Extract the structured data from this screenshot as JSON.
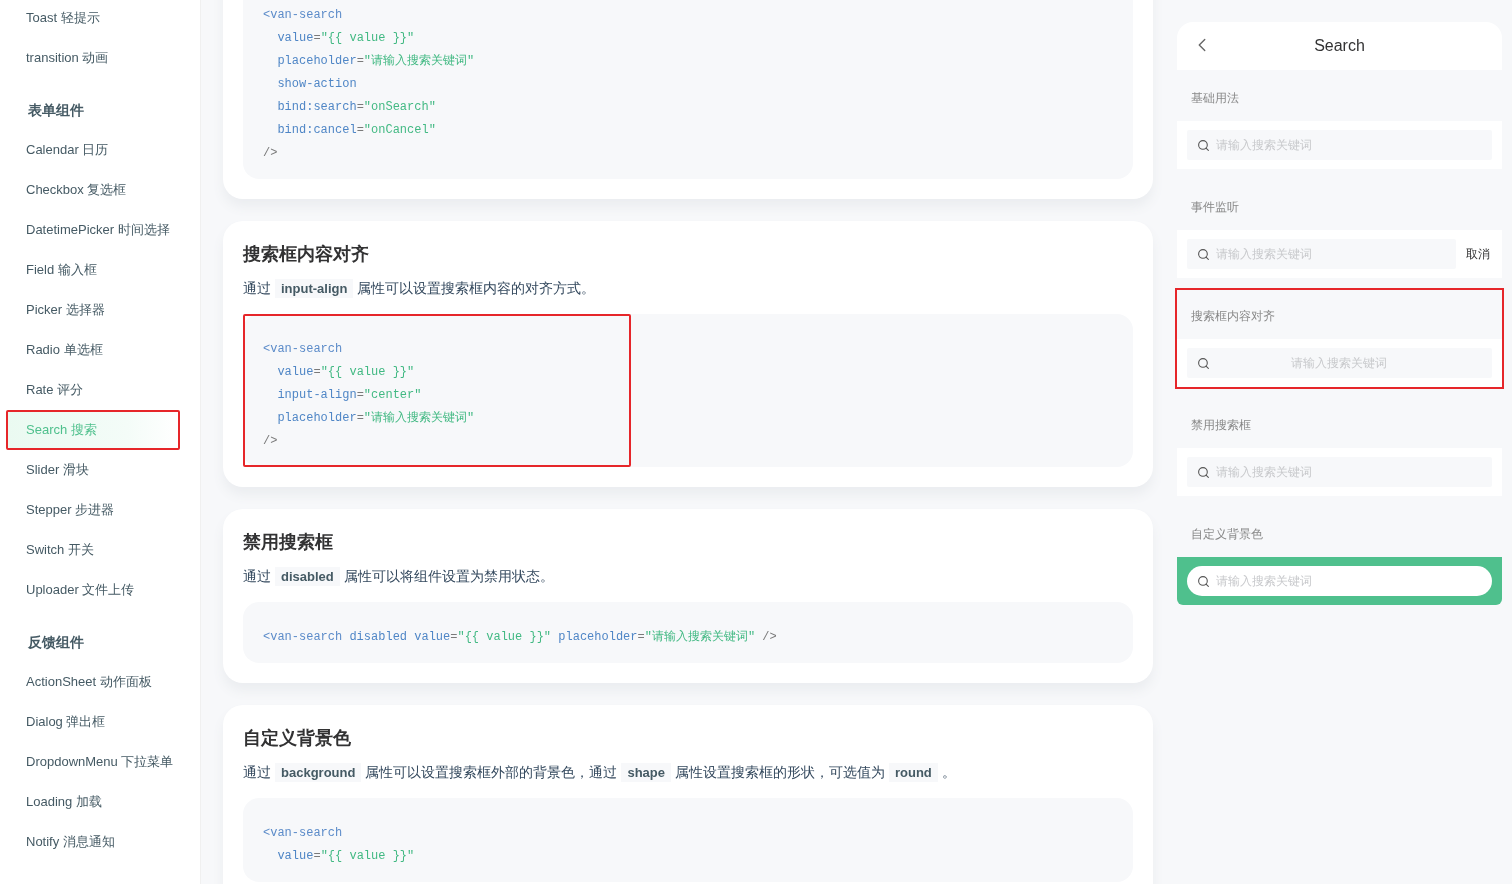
{
  "sidebar": {
    "items": [
      {
        "kind": "link",
        "label": "Toast 轻提示",
        "selected": false,
        "highlighted": false
      },
      {
        "kind": "link",
        "label": "transition 动画",
        "selected": false,
        "highlighted": false
      },
      {
        "kind": "heading",
        "label": "表单组件"
      },
      {
        "kind": "link",
        "label": "Calendar 日历",
        "selected": false,
        "highlighted": false
      },
      {
        "kind": "link",
        "label": "Checkbox 复选框",
        "selected": false,
        "highlighted": false
      },
      {
        "kind": "link",
        "label": "DatetimePicker 时间选择",
        "selected": false,
        "highlighted": false
      },
      {
        "kind": "link",
        "label": "Field 输入框",
        "selected": false,
        "highlighted": false
      },
      {
        "kind": "link",
        "label": "Picker 选择器",
        "selected": false,
        "highlighted": false
      },
      {
        "kind": "link",
        "label": "Radio 单选框",
        "selected": false,
        "highlighted": false
      },
      {
        "kind": "link",
        "label": "Rate 评分",
        "selected": false,
        "highlighted": false
      },
      {
        "kind": "link",
        "label": "Search 搜索",
        "selected": true,
        "highlighted": true
      },
      {
        "kind": "link",
        "label": "Slider 滑块",
        "selected": false,
        "highlighted": false
      },
      {
        "kind": "link",
        "label": "Stepper 步进器",
        "selected": false,
        "highlighted": false
      },
      {
        "kind": "link",
        "label": "Switch 开关",
        "selected": false,
        "highlighted": false
      },
      {
        "kind": "link",
        "label": "Uploader 文件上传",
        "selected": false,
        "highlighted": false
      },
      {
        "kind": "heading",
        "label": "反馈组件"
      },
      {
        "kind": "link",
        "label": "ActionSheet 动作面板",
        "selected": false,
        "highlighted": false
      },
      {
        "kind": "link",
        "label": "Dialog 弹出框",
        "selected": false,
        "highlighted": false
      },
      {
        "kind": "link",
        "label": "DropdownMenu 下拉菜单",
        "selected": false,
        "highlighted": false
      },
      {
        "kind": "link",
        "label": "Loading 加载",
        "selected": false,
        "highlighted": false
      },
      {
        "kind": "link",
        "label": "Notify 消息通知",
        "selected": false,
        "highlighted": false
      }
    ]
  },
  "cards": [
    {
      "code": {
        "highlighted": false,
        "lines": [
          [
            {
              "kind": "tag",
              "text": "<van-search"
            }
          ],
          [
            {
              "kind": "attr",
              "text": "  value"
            },
            {
              "kind": "punct",
              "text": "="
            },
            {
              "kind": "string",
              "text": "\"{{ value }}\""
            }
          ],
          [
            {
              "kind": "attr",
              "text": "  placeholder"
            },
            {
              "kind": "punct",
              "text": "="
            },
            {
              "kind": "string",
              "text": "\"请输入搜索关键词\""
            }
          ],
          [
            {
              "kind": "attr",
              "text": "  show-action"
            }
          ],
          [
            {
              "kind": "attr",
              "text": "  bind:search"
            },
            {
              "kind": "punct",
              "text": "="
            },
            {
              "kind": "string",
              "text": "\"onSearch\""
            }
          ],
          [
            {
              "kind": "attr",
              "text": "  bind:cancel"
            },
            {
              "kind": "punct",
              "text": "="
            },
            {
              "kind": "string",
              "text": "\"onCancel\""
            }
          ],
          [
            {
              "kind": "punct",
              "text": "/>"
            }
          ]
        ]
      }
    },
    {
      "title": "搜索框内容对齐",
      "description": [
        {
          "kind": "text",
          "text": "通过"
        },
        {
          "kind": "code",
          "text": "input-align"
        },
        {
          "kind": "text",
          "text": "属性可以设置搜索框内容的对齐方式。"
        }
      ],
      "code": {
        "highlighted": true,
        "lines": [
          [
            {
              "kind": "tag",
              "text": "<van-search"
            }
          ],
          [
            {
              "kind": "attr",
              "text": "  value"
            },
            {
              "kind": "punct",
              "text": "="
            },
            {
              "kind": "string",
              "text": "\"{{ value }}\""
            }
          ],
          [
            {
              "kind": "attr",
              "text": "  input-align"
            },
            {
              "kind": "punct",
              "text": "="
            },
            {
              "kind": "string",
              "text": "\"center\""
            }
          ],
          [
            {
              "kind": "attr",
              "text": "  placeholder"
            },
            {
              "kind": "punct",
              "text": "="
            },
            {
              "kind": "string",
              "text": "\"请输入搜索关键词\""
            }
          ],
          [
            {
              "kind": "punct",
              "text": "/>"
            }
          ]
        ]
      }
    },
    {
      "title": "禁用搜索框",
      "description": [
        {
          "kind": "text",
          "text": "通过"
        },
        {
          "kind": "code",
          "text": "disabled"
        },
        {
          "kind": "text",
          "text": "属性可以将组件设置为禁用状态。"
        }
      ],
      "code": {
        "highlighted": false,
        "lines": [
          [
            {
              "kind": "tag",
              "text": "<van-search"
            },
            {
              "kind": "attr",
              "text": " disabled value"
            },
            {
              "kind": "punct",
              "text": "="
            },
            {
              "kind": "string",
              "text": "\"{{ value }}\""
            },
            {
              "kind": "attr",
              "text": " placeholder"
            },
            {
              "kind": "punct",
              "text": "="
            },
            {
              "kind": "string",
              "text": "\"请输入搜索关键词\""
            },
            {
              "kind": "punct",
              "text": " />"
            }
          ]
        ]
      }
    },
    {
      "title": "自定义背景色",
      "description": [
        {
          "kind": "text",
          "text": "通过"
        },
        {
          "kind": "code",
          "text": "background"
        },
        {
          "kind": "text",
          "text": "属性可以设置搜索框外部的背景色，通过"
        },
        {
          "kind": "code",
          "text": "shape"
        },
        {
          "kind": "text",
          "text": "属性设置搜索框的形状，可选值为"
        },
        {
          "kind": "code",
          "text": "round"
        },
        {
          "kind": "text",
          "text": "。"
        }
      ],
      "code": {
        "highlighted": false,
        "lines": [
          [
            {
              "kind": "tag",
              "text": "<van-search"
            }
          ],
          [
            {
              "kind": "attr",
              "text": "  value"
            },
            {
              "kind": "punct",
              "text": "="
            },
            {
              "kind": "string",
              "text": "\"{{ value }}\""
            }
          ]
        ]
      }
    }
  ],
  "preview": {
    "nav": {
      "title": "Search"
    },
    "demos": [
      {
        "title": "基础用法",
        "placeholder": "请输入搜索关键词",
        "centered": false,
        "highlighted": false
      },
      {
        "title": "事件监听",
        "placeholder": "请输入搜索关键词",
        "centered": false,
        "action": "取消",
        "highlighted": false
      },
      {
        "title": "搜索框内容对齐",
        "placeholder": "请输入搜索关键词",
        "centered": true,
        "highlighted": true
      },
      {
        "title": "禁用搜索框",
        "placeholder": "请输入搜索关键词",
        "centered": false,
        "highlighted": false
      },
      {
        "title": "自定义背景色",
        "placeholder": "请输入搜索关键词",
        "centered": false,
        "round": true,
        "color": "#4fc08d",
        "highlighted": false
      }
    ]
  }
}
